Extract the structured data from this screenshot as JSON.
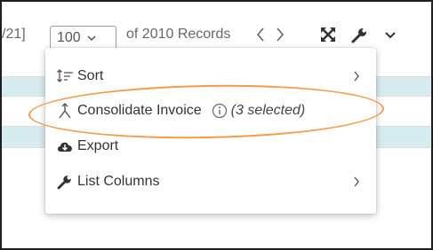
{
  "toolbar": {
    "range_fragment": "/21]",
    "page_size": "100",
    "records_text": "of 2010 Records"
  },
  "menu": {
    "items": [
      {
        "label": "Sort",
        "icon": "sort-icon",
        "has_submenu": true
      },
      {
        "label": "Consolidate Invoice",
        "icon": "merge-icon",
        "note": "(3 selected)",
        "info_icon": "info-icon"
      },
      {
        "label": "Export",
        "icon": "cloud-download-icon"
      },
      {
        "label": "List Columns",
        "icon": "wrench-icon",
        "has_submenu": true
      }
    ]
  },
  "colors": {
    "highlight": "#f39c4c",
    "row_tint": "#d7ecef",
    "text": "#333333"
  }
}
